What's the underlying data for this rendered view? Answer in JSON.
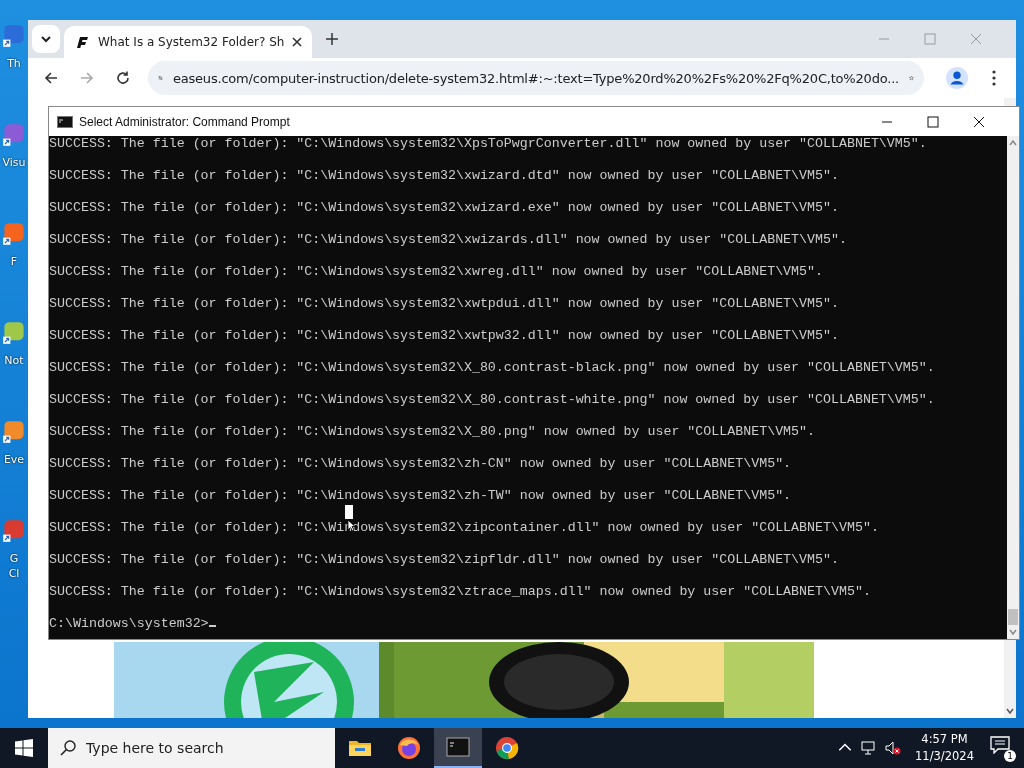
{
  "desktop_icons": [
    {
      "label": "Th",
      "color": "#2b6cd9"
    },
    {
      "label": "Visu",
      "color": "#8b5cd6"
    },
    {
      "label": "F",
      "color": "#f5641e"
    },
    {
      "label": "Not",
      "color": "#9fc84a"
    },
    {
      "label": "Eve",
      "color": "#f08a2a"
    },
    {
      "label": "G Cl",
      "color": "#d93b30"
    }
  ],
  "browser": {
    "tab_title": "What Is a System32 Folder? Sh",
    "url": "easeus.com/computer-instruction/delete-system32.html#:~:text=Type%20rd%20%2Fs%20%2Fq%20C,to%20do..."
  },
  "console": {
    "title": "Select Administrator: Command Prompt",
    "lines": [
      "SUCCESS: The file (or folder): \"C:\\Windows\\system32\\XpsToPwgrConverter.dll\" now owned by user \"COLLABNET\\VM5\".",
      "SUCCESS: The file (or folder): \"C:\\Windows\\system32\\xwizard.dtd\" now owned by user \"COLLABNET\\VM5\".",
      "SUCCESS: The file (or folder): \"C:\\Windows\\system32\\xwizard.exe\" now owned by user \"COLLABNET\\VM5\".",
      "SUCCESS: The file (or folder): \"C:\\Windows\\system32\\xwizards.dll\" now owned by user \"COLLABNET\\VM5\".",
      "SUCCESS: The file (or folder): \"C:\\Windows\\system32\\xwreg.dll\" now owned by user \"COLLABNET\\VM5\".",
      "SUCCESS: The file (or folder): \"C:\\Windows\\system32\\xwtpdui.dll\" now owned by user \"COLLABNET\\VM5\".",
      "SUCCESS: The file (or folder): \"C:\\Windows\\system32\\xwtpw32.dll\" now owned by user \"COLLABNET\\VM5\".",
      "SUCCESS: The file (or folder): \"C:\\Windows\\system32\\X_80.contrast-black.png\" now owned by user \"COLLABNET\\VM5\".",
      "SUCCESS: The file (or folder): \"C:\\Windows\\system32\\X_80.contrast-white.png\" now owned by user \"COLLABNET\\VM5\".",
      "SUCCESS: The file (or folder): \"C:\\Windows\\system32\\X_80.png\" now owned by user \"COLLABNET\\VM5\".",
      "SUCCESS: The file (or folder): \"C:\\Windows\\system32\\zh-CN\" now owned by user \"COLLABNET\\VM5\".",
      "SUCCESS: The file (or folder): \"C:\\Windows\\system32\\zh-TW\" now owned by user \"COLLABNET\\VM5\".",
      "SUCCESS: The file (or folder): \"C:\\Windows\\system32\\zipcontainer.dll\" now owned by user \"COLLABNET\\VM5\".",
      "SUCCESS: The file (or folder): \"C:\\Windows\\system32\\zipfldr.dll\" now owned by user \"COLLABNET\\VM5\".",
      "SUCCESS: The file (or folder): \"C:\\Windows\\system32\\ztrace_maps.dll\" now owned by user \"COLLABNET\\VM5\"."
    ],
    "prompt": "C:\\Windows\\system32>"
  },
  "taskbar": {
    "search": {
      "placeholder": "Type here to search"
    },
    "apps": [
      {
        "kind": "folder",
        "selected": false
      },
      {
        "kind": "firefox",
        "selected": false
      },
      {
        "kind": "terminal",
        "selected": true
      },
      {
        "kind": "chrome",
        "selected": false
      }
    ],
    "time": "4:57 PM",
    "date": "11/3/2024",
    "notification_count": "1"
  }
}
